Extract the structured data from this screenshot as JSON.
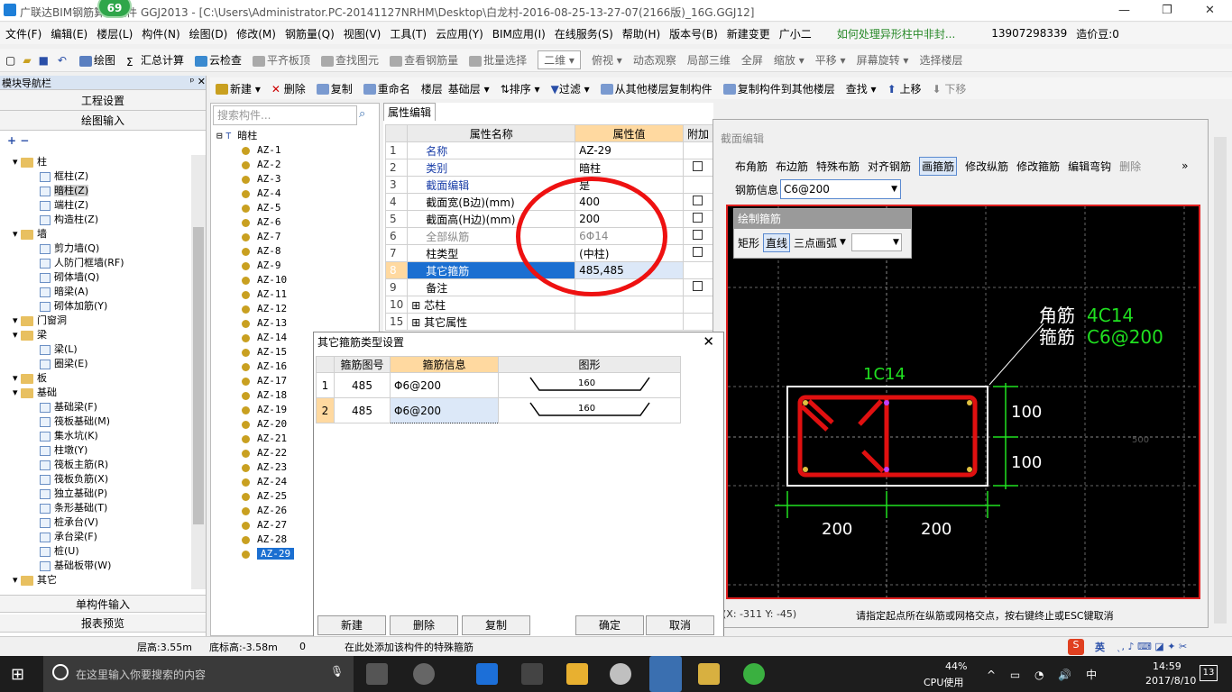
{
  "title_bar": {
    "text": "广联达BIM钢筋算量软件 GGJ2013 - [C:\\Users\\Administrator.PC-20141127NRHM\\Desktop\\白龙村-2016-08-25-13-27-07(2166版)_16G.GGJ12]",
    "badge": "69"
  },
  "menu": [
    "文件(F)",
    "编辑(E)",
    "楼层(L)",
    "构件(N)",
    "绘图(D)",
    "修改(M)",
    "钢筋量(Q)",
    "视图(V)",
    "工具(T)",
    "云应用(Y)",
    "BIM应用(I)",
    "在线服务(S)",
    "帮助(H)",
    "版本号(B)",
    "新建变更",
    "广小二",
    "如何处理异形柱中非封...",
    "13907298339",
    "造价豆:0"
  ],
  "toolbar1": [
    "绘图",
    "汇总计算",
    "云检查",
    "平齐板顶",
    "查找图元",
    "查看钢筋量",
    "批量选择",
    "二维",
    "俯视",
    "动态观察",
    "局部三维",
    "全屏",
    "缩放",
    "平移",
    "屏幕旋转",
    "选择楼层"
  ],
  "nav": {
    "header": "模块导航栏",
    "buttons": [
      "工程设置",
      "绘图输入"
    ],
    "tree": [
      {
        "label": "柱",
        "level": 0,
        "folder": true
      },
      {
        "label": "框柱(Z)",
        "level": 1
      },
      {
        "label": "暗柱(Z)",
        "level": 1
      },
      {
        "label": "端柱(Z)",
        "level": 1
      },
      {
        "label": "构造柱(Z)",
        "level": 1
      },
      {
        "label": "墙",
        "level": 0,
        "folder": true
      },
      {
        "label": "剪力墙(Q)",
        "level": 1
      },
      {
        "label": "人防门框墙(RF)",
        "level": 1
      },
      {
        "label": "砌体墙(Q)",
        "level": 1
      },
      {
        "label": "暗梁(A)",
        "level": 1
      },
      {
        "label": "砌体加筋(Y)",
        "level": 1
      },
      {
        "label": "门窗洞",
        "level": 0,
        "folder": true
      },
      {
        "label": "梁",
        "level": 0,
        "folder": true
      },
      {
        "label": "梁(L)",
        "level": 1
      },
      {
        "label": "圈梁(E)",
        "level": 1
      },
      {
        "label": "板",
        "level": 0,
        "folder": true
      },
      {
        "label": "基础",
        "level": 0,
        "folder": true
      },
      {
        "label": "基础梁(F)",
        "level": 1
      },
      {
        "label": "筏板基础(M)",
        "level": 1
      },
      {
        "label": "集水坑(K)",
        "level": 1
      },
      {
        "label": "柱墩(Y)",
        "level": 1
      },
      {
        "label": "筏板主筋(R)",
        "level": 1
      },
      {
        "label": "筏板负筋(X)",
        "level": 1
      },
      {
        "label": "独立基础(P)",
        "level": 1
      },
      {
        "label": "条形基础(T)",
        "level": 1
      },
      {
        "label": "桩承台(V)",
        "level": 1
      },
      {
        "label": "承台梁(F)",
        "level": 1
      },
      {
        "label": "桩(U)",
        "level": 1
      },
      {
        "label": "基础板带(W)",
        "level": 1
      },
      {
        "label": "其它",
        "level": 0,
        "folder": true
      }
    ],
    "bottom_buttons": [
      "单构件输入",
      "报表预览"
    ]
  },
  "comp_toolbar": [
    "新建",
    "删除",
    "复制",
    "重命名",
    "楼层",
    "基础层",
    "排序",
    "过滤",
    "从其他楼层复制构件",
    "复制构件到其他楼层",
    "查找",
    "上移",
    "下移"
  ],
  "comp_list": {
    "search_placeholder": "搜索构件...",
    "root": "暗柱",
    "items": [
      "AZ-1",
      "AZ-2",
      "AZ-3",
      "AZ-4",
      "AZ-5",
      "AZ-6",
      "AZ-7",
      "AZ-8",
      "AZ-9",
      "AZ-10",
      "AZ-11",
      "AZ-12",
      "AZ-13",
      "AZ-14",
      "AZ-15",
      "AZ-16",
      "AZ-17",
      "AZ-18",
      "AZ-19",
      "AZ-20",
      "AZ-21",
      "AZ-22",
      "AZ-23",
      "AZ-24",
      "AZ-25",
      "AZ-26",
      "AZ-27",
      "AZ-28",
      "AZ-29"
    ]
  },
  "prop": {
    "tab": "属性编辑",
    "headers": [
      "属性名称",
      "属性值",
      "附加"
    ],
    "rows": [
      {
        "n": "1",
        "name": "名称",
        "value": "AZ-29",
        "blue": true,
        "check": false
      },
      {
        "n": "2",
        "name": "类别",
        "value": "暗柱",
        "blue": true,
        "check": true
      },
      {
        "n": "3",
        "name": "截面编辑",
        "value": "是",
        "blue": true,
        "check": false
      },
      {
        "n": "4",
        "name": "截面宽(B边)(mm)",
        "value": "400",
        "check": true
      },
      {
        "n": "5",
        "name": "截面高(H边)(mm)",
        "value": "200",
        "check": true
      },
      {
        "n": "6",
        "name": "全部纵筋",
        "value": "6Φ14",
        "gray": true,
        "check": true
      },
      {
        "n": "7",
        "name": "柱类型",
        "value": "(中柱)",
        "check": true
      },
      {
        "n": "8",
        "name": "其它箍筋",
        "value": "485,485",
        "selected": true,
        "check": false
      },
      {
        "n": "9",
        "name": "备注",
        "value": "",
        "check": true
      },
      {
        "n": "10",
        "name": "芯柱",
        "value": "",
        "expand": true,
        "check": false
      },
      {
        "n": "15",
        "name": "其它属性",
        "value": "",
        "expand": true,
        "check": false
      }
    ]
  },
  "dialog": {
    "title": "其它箍筋类型设置",
    "headers": [
      "",
      "箍筋图号",
      "箍筋信息",
      "图形"
    ],
    "rows": [
      {
        "n": "1",
        "code": "485",
        "info": "Φ6@200",
        "len": "160"
      },
      {
        "n": "2",
        "code": "485",
        "info": "Φ6@200",
        "len": "160"
      }
    ],
    "buttons": [
      "新建",
      "删除",
      "复制",
      "确定",
      "取消"
    ]
  },
  "section": {
    "title": "截面编辑",
    "tools": [
      "布角筋",
      "布边筋",
      "特殊布筋",
      "对齐钢筋",
      "画箍筋",
      "修改纵筋",
      "修改箍筋",
      "编辑弯钩",
      "删除"
    ],
    "rebar_label": "钢筋信息",
    "rebar_value": "C6@200",
    "draw_panel": {
      "title": "绘制箍筋",
      "items": [
        "矩形",
        "直线",
        "三点画弧"
      ]
    },
    "labels": {
      "corner": "角筋",
      "corner_val": "4C14",
      "stirrup": "箍筋",
      "stirrup_val": "C6@200",
      "side": "1C14",
      "dim_h1": "100",
      "dim_h2": "100",
      "dim_w1": "200",
      "dim_w2": "200",
      "grid": "500"
    },
    "coord": "(X: -311 Y: -45)",
    "hint": "请指定起点所在纵筋或网格交点，按右键终止或ESC键取消"
  },
  "status": {
    "floor_height": "层高:3.55m",
    "bottom": "底标高:-3.58m",
    "zero": "0",
    "msg": "在此处添加该构件的特殊箍筋"
  },
  "taskbar": {
    "search": "在这里输入你要搜索的内容",
    "cpu_pct": "44%",
    "cpu_label": "CPU使用",
    "time": "14:59",
    "date": "2017/8/10",
    "ime": "英",
    "notif": "13"
  }
}
